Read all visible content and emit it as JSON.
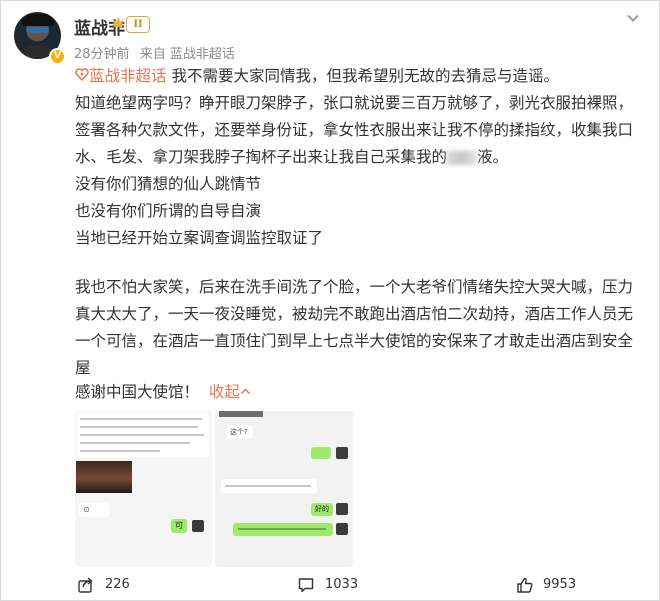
{
  "header": {
    "name": "蓝战非",
    "time": "28分钟前",
    "source": "来自 蓝战非超话"
  },
  "post": {
    "topic": "蓝战非超话",
    "line1": " 我不需要大家同情我，但我希望别无故的去猜忌与造谣。",
    "para1": "知道绝望两字吗？睁开眼刀架脖子，张口就说要三百万就够了，剥光衣服拍裸照，签署各种欠款文件，还要举身份证，拿女性衣服出来让我不停的揉指纹，收集我口水、毛发、拿刀架我脖子掏杯子出来让我自己采集我的",
    "para1_tail": "液。",
    "line_a": "没有你们猜想的仙人跳情节",
    "line_b": "也没有你们所谓的自导自演",
    "line_c": "当地已经开始立案调查调监控取证了",
    "para2": "我也不怕大家笑，后来在洗手间洗了个脸，一个大老爷们情绪失控大哭大喊，压力真大太大了，一天一夜没睡觉，被劫完不敢跑出酒店怕二次劫持，酒店工作人员无一个可信，在酒店一直顶住门到早上七点半大使馆的安保来了才敢走出酒店到安全屋",
    "thanks": "感谢中国大使馆！",
    "collapse": "收起"
  },
  "attachments": {
    "chat1_bubbles": [
      "⊙",
      "可"
    ],
    "chat2_bubbles": [
      "这个?",
      "好的",
      "好滴"
    ]
  },
  "footer": {
    "share_count": "226",
    "comment_count": "1033",
    "like_count": "9953"
  },
  "colors": {
    "accent": "#eb7350",
    "text": "#333333",
    "meta": "#8c8c8c",
    "wechat_green": "#9eea6a",
    "vip_gold": "#f7b500"
  },
  "icons": [
    "avatar",
    "verified-badge-icon",
    "level-badge-icon",
    "crown-icon",
    "chevron-down-icon",
    "topic-icon",
    "share-icon",
    "comment-icon",
    "like-icon"
  ]
}
